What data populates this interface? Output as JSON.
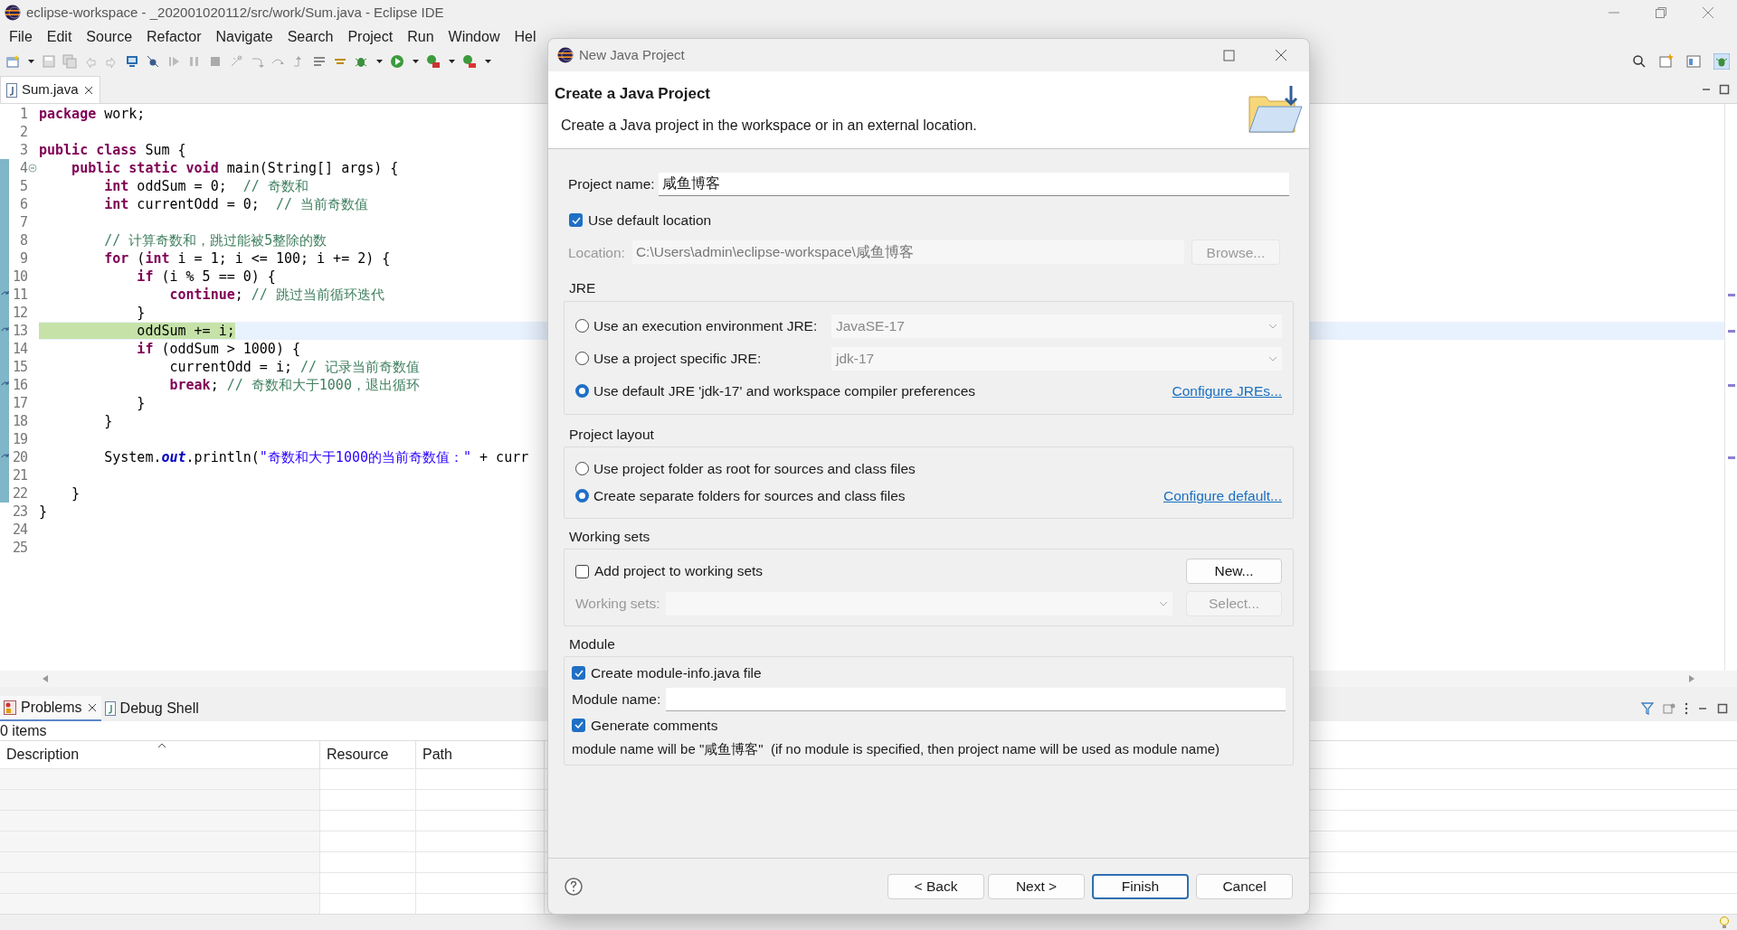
{
  "window": {
    "title": "eclipse-workspace - _202001020112/src/work/Sum.java - Eclipse IDE"
  },
  "menu": [
    "File",
    "Edit",
    "Source",
    "Refactor",
    "Navigate",
    "Search",
    "Project",
    "Run",
    "Window",
    "Hel"
  ],
  "editor": {
    "tabs": [
      {
        "label": "Sum.java",
        "selected": true
      }
    ],
    "lines": [
      {
        "number": "1",
        "tokens": [
          {
            "kind": "kw",
            "text": "package"
          },
          {
            "kind": "plain",
            "text": " work;"
          }
        ],
        "in_range": false,
        "marker": false,
        "fold": false,
        "current": false,
        "debug": false
      },
      {
        "number": "2",
        "in_range": false,
        "marker": false,
        "fold": false,
        "current": false,
        "debug": false
      },
      {
        "number": "3",
        "tokens": [
          {
            "kind": "kw",
            "text": "public"
          },
          {
            "kind": "kw",
            "text": " class"
          },
          {
            "kind": "plain",
            "text": " Sum {"
          }
        ],
        "in_range": false,
        "marker": false,
        "fold": false,
        "current": false,
        "debug": false
      },
      {
        "number": "4",
        "tokens": [
          {
            "kind": "kw",
            "text": "    public"
          },
          {
            "kind": "kw",
            "text": " static"
          },
          {
            "kind": "kw",
            "text": " void"
          },
          {
            "kind": "plain",
            "text": " main(String[] args) {"
          }
        ],
        "in_range": true,
        "marker": false,
        "fold": true,
        "current": false,
        "debug": false
      },
      {
        "number": "5",
        "tokens": [
          {
            "kind": "kw",
            "text": "        int"
          },
          {
            "kind": "plain",
            "text": " oddSum = 0;  "
          },
          {
            "kind": "comment",
            "text": "// 奇数和"
          }
        ],
        "in_range": true,
        "marker": false,
        "fold": false,
        "current": false,
        "debug": false
      },
      {
        "number": "6",
        "tokens": [
          {
            "kind": "kw",
            "text": "        int"
          },
          {
            "kind": "plain",
            "text": " currentOdd = 0;  "
          },
          {
            "kind": "comment",
            "text": "// 当前奇数值"
          }
        ],
        "in_range": true,
        "marker": false,
        "fold": false,
        "current": false,
        "debug": false
      },
      {
        "number": "7",
        "in_range": true,
        "marker": false,
        "fold": false,
        "current": false,
        "debug": false
      },
      {
        "number": "8",
        "tokens": [
          {
            "kind": "comment",
            "text": "        // 计算奇数和，跳过能被5整除的数"
          }
        ],
        "in_range": true,
        "marker": false,
        "fold": false,
        "current": false,
        "debug": false
      },
      {
        "number": "9",
        "tokens": [
          {
            "kind": "kw",
            "text": "        for"
          },
          {
            "kind": "plain",
            "text": " ("
          },
          {
            "kind": "kw",
            "text": "int"
          },
          {
            "kind": "plain",
            "text": " i = 1; i <= 100; i += 2) {"
          }
        ],
        "in_range": true,
        "marker": false,
        "fold": false,
        "current": false,
        "debug": false
      },
      {
        "number": "10",
        "tokens": [
          {
            "kind": "kw",
            "text": "            if"
          },
          {
            "kind": "plain",
            "text": " (i % 5 == 0) {"
          }
        ],
        "in_range": true,
        "marker": false,
        "fold": false,
        "current": false,
        "debug": false
      },
      {
        "number": "11",
        "tokens": [
          {
            "kind": "kw",
            "text": "                continue"
          },
          {
            "kind": "plain",
            "text": "; "
          },
          {
            "kind": "comment",
            "text": "// 跳过当前循环迭代"
          }
        ],
        "in_range": true,
        "marker": true,
        "fold": false,
        "current": false,
        "debug": false
      },
      {
        "number": "12",
        "tokens": [
          {
            "kind": "plain",
            "text": "            }"
          }
        ],
        "in_range": true,
        "marker": false,
        "fold": false,
        "current": false,
        "debug": false
      },
      {
        "number": "13",
        "tokens": [
          {
            "kind": "plain",
            "text": "            oddSum += i;"
          }
        ],
        "in_range": true,
        "marker": true,
        "fold": false,
        "current": true,
        "debug": true
      },
      {
        "number": "14",
        "tokens": [
          {
            "kind": "kw",
            "text": "            if"
          },
          {
            "kind": "plain",
            "text": " (oddSum > 1000) {"
          }
        ],
        "in_range": true,
        "marker": false,
        "fold": false,
        "current": false,
        "debug": false
      },
      {
        "number": "15",
        "tokens": [
          {
            "kind": "plain",
            "text": "                currentOdd = i; "
          },
          {
            "kind": "comment",
            "text": "// 记录当前奇数值"
          }
        ],
        "in_range": true,
        "marker": false,
        "fold": false,
        "current": false,
        "debug": false
      },
      {
        "number": "16",
        "tokens": [
          {
            "kind": "kw",
            "text": "                break"
          },
          {
            "kind": "plain",
            "text": "; "
          },
          {
            "kind": "comment",
            "text": "// 奇数和大于1000，退出循环"
          }
        ],
        "in_range": true,
        "marker": true,
        "fold": false,
        "current": false,
        "debug": false
      },
      {
        "number": "17",
        "tokens": [
          {
            "kind": "plain",
            "text": "            }"
          }
        ],
        "in_range": true,
        "marker": false,
        "fold": false,
        "current": false,
        "debug": false
      },
      {
        "number": "18",
        "tokens": [
          {
            "kind": "plain",
            "text": "        }"
          }
        ],
        "in_range": true,
        "marker": false,
        "fold": false,
        "current": false,
        "debug": false
      },
      {
        "number": "19",
        "in_range": true,
        "marker": false,
        "fold": false,
        "current": false,
        "debug": false
      },
      {
        "number": "20",
        "tokens": [
          {
            "kind": "plain",
            "text": "        System."
          },
          {
            "kind": "field",
            "text": "out"
          },
          {
            "kind": "plain",
            "text": ".println("
          },
          {
            "kind": "string",
            "text": "\"奇数和大于1000的当前奇数值：\""
          },
          {
            "kind": "plain",
            "text": " + curr"
          }
        ],
        "in_range": true,
        "marker": true,
        "fold": false,
        "current": false,
        "debug": false
      },
      {
        "number": "21",
        "in_range": true,
        "marker": false,
        "fold": false,
        "current": false,
        "debug": false
      },
      {
        "number": "22",
        "tokens": [
          {
            "kind": "plain",
            "text": "    }"
          }
        ],
        "in_range": true,
        "marker": false,
        "fold": false,
        "current": false,
        "debug": false
      },
      {
        "number": "23",
        "tokens": [
          {
            "kind": "plain",
            "text": "}"
          }
        ],
        "in_range": false,
        "marker": false,
        "fold": false,
        "current": false,
        "debug": false
      },
      {
        "number": "24",
        "in_range": false,
        "marker": false,
        "fold": false,
        "current": false,
        "debug": false
      },
      {
        "number": "25",
        "in_range": false,
        "marker": false,
        "fold": false,
        "current": false,
        "debug": false
      }
    ]
  },
  "bottom_panel": {
    "tabs": [
      {
        "label": "Problems",
        "selected": true,
        "closable": true
      },
      {
        "label": "Debug Shell",
        "selected": false,
        "closable": false
      }
    ],
    "summary": "0 items",
    "columns": [
      "Description",
      "Resource",
      "Path"
    ]
  },
  "dialog": {
    "title": "New Java Project",
    "heading": "Create a Java Project",
    "description": "Create a Java project in the workspace or in an external location.",
    "project_name": {
      "label": "Project name:",
      "value": "咸鱼博客"
    },
    "default_location": {
      "label": "Use default location",
      "checked": true
    },
    "location": {
      "label": "Location:",
      "value": "C:\\Users\\admin\\eclipse-workspace\\咸鱼博客",
      "disabled": true,
      "button": "Browse..."
    },
    "jre": {
      "title": "JRE",
      "options": [
        {
          "label": "Use an execution environment JRE:",
          "selected": false,
          "combo": {
            "value": "JavaSE-17",
            "disabled": true
          }
        },
        {
          "label": "Use a project specific JRE:",
          "selected": false,
          "combo": {
            "value": "jdk-17",
            "disabled": true
          }
        },
        {
          "label": "Use default JRE 'jdk-17' and workspace compiler preferences",
          "selected": true,
          "link": "Configure JREs..."
        }
      ]
    },
    "layout": {
      "title": "Project layout",
      "options": [
        {
          "label": "Use project folder as root for sources and class files",
          "selected": false
        },
        {
          "label": "Create separate folders for sources and class files",
          "selected": true,
          "link": "Configure default..."
        }
      ]
    },
    "working_sets": {
      "title": "Working sets",
      "add": {
        "label": "Add project to working sets",
        "checked": false
      },
      "new_button": "New...",
      "field": {
        "label": "Working sets:",
        "disabled": true
      },
      "select_button": {
        "label": "Select...",
        "disabled": true
      }
    },
    "module": {
      "title": "Module",
      "create": {
        "label": "Create module-info.java file",
        "checked": true
      },
      "name_label": "Module name:",
      "comments": {
        "label": "Generate comments",
        "checked": true
      },
      "note": "module name will be \"咸鱼博客\"  (if no module is specified, then project name will be used as module name)"
    },
    "buttons": [
      {
        "label": "< Back",
        "default": false
      },
      {
        "label": "Next >",
        "default": false
      },
      {
        "label": "Finish",
        "default": true
      },
      {
        "label": "Cancel",
        "default": false
      }
    ]
  }
}
